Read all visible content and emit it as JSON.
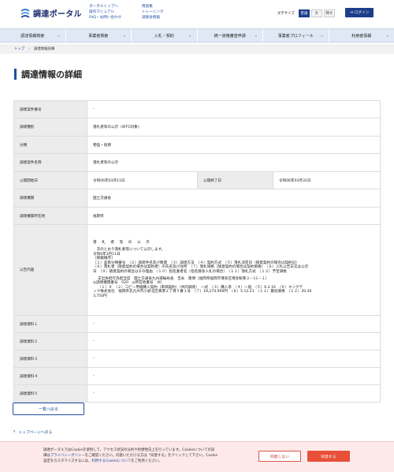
{
  "header": {
    "logo_text": "調達ポータル",
    "links_col1": [
      "ポータルトップへ",
      "操作マニュアル",
      "FAQ・お問い合わせ"
    ],
    "links_col2": [
      "用語集",
      "トレーニング",
      "調達会情報"
    ],
    "font_size_label": "文字サイズ",
    "font_sizes": [
      "普通",
      "大",
      "特大"
    ],
    "login_label": "ログイン"
  },
  "nav": {
    "items": [
      "調達情報検索",
      "事業者検索",
      "入札・契約",
      "統一資格審査申請",
      "事業者プロフィール",
      "利用者情報"
    ]
  },
  "breadcrumb": {
    "home": "トップ",
    "current": "調達情報詳細"
  },
  "page_title": "調達情報の詳細",
  "detail": {
    "rows": [
      {
        "label": "調達案件番号",
        "value": "-"
      },
      {
        "label": "調達種別",
        "value": "落札者等の公示（WTO対象）"
      },
      {
        "label": "分類",
        "value": "物品・役務"
      },
      {
        "label": "調達案件名称",
        "value": "落札者等の公示"
      },
      {
        "label": "公開開始日",
        "value": "令和06年03月11日",
        "label2": "公開終了日",
        "value2": "令和06年03月31日"
      },
      {
        "label": "調達機関",
        "value": "国土交通省"
      },
      {
        "label": "調達機関所在地",
        "value": "福岡県"
      },
      {
        "label": "公告内容",
        "notice": [
          "落　札　者　等　の　公　示",
          "",
          "　次のとおり落札者等について公示します。",
          "令和6年3月11日",
          "［掲載順序］",
          "（１）品目分類番号　（２）調達件名及び数量　（３）調達方法　（４）契約方式　（５）落札決定日（随意契約の場合は契約日）",
          "（６）落札者（随意契約の場合は契約者）の氏名及び住所　（７）落札価格（随意契約の場合は契約価格）　（８）入札公告日又は公示",
          "日　（９）随意契約の場合はその理由　（１０）指名業者名（指名競争入札の場合）　（１１）落札方式　（１２）予定価格",
          "",
          "支出負担行為担当官　国土交通省九州運輸局長　吉永　隆博（福岡県福岡市博多区博多駅東２－11－１）",
          "◎調達機関番号　020　◎所在地番号　40",
          "（１）６　（２）コピー用紙購入契約（単価契約）（共同調達）　一式　（３）購入等　（４）一般　（５）6.2.16　（６）キングテ",
          "ック株式会社　福岡県北九州市小倉北区東港２丁目５番１号　（７）18,274,900円　（８）5.12.21　（１１）最低価格　（１２）20,30",
          "3,750円"
        ]
      },
      {
        "label": "調達資料１",
        "value": "-"
      },
      {
        "label": "調達資料２",
        "value": "-"
      },
      {
        "label": "調達資料３",
        "value": "-"
      },
      {
        "label": "調達資料４",
        "value": "-"
      },
      {
        "label": "調達資料５",
        "value": "-"
      }
    ]
  },
  "back_button": "一覧へ戻る",
  "page_top_link": "トップページへ戻る",
  "cookie": {
    "text_1": "調達ポータルではCookieを使用して、アクセス状況の分析や利便性向上を行っています。Cookieについての詳",
    "text_2a": "細は",
    "policy_link": "プライバシーポリシー",
    "text_2b": "をご確認ください。同意いただける方は「同意する」をクリックして下さい。Cookie",
    "text_3a": "設定をカスタマイズするには、",
    "settings_link": "利用するCookieについて",
    "text_3b": "をご利用ください。",
    "deny_label": "同意しない",
    "accept_label": "同意する"
  },
  "colors": {
    "brand": "#1e3e8c",
    "link": "#1e4fa0",
    "nav_bg": "#dfe8f4",
    "accept": "#e8503a"
  }
}
